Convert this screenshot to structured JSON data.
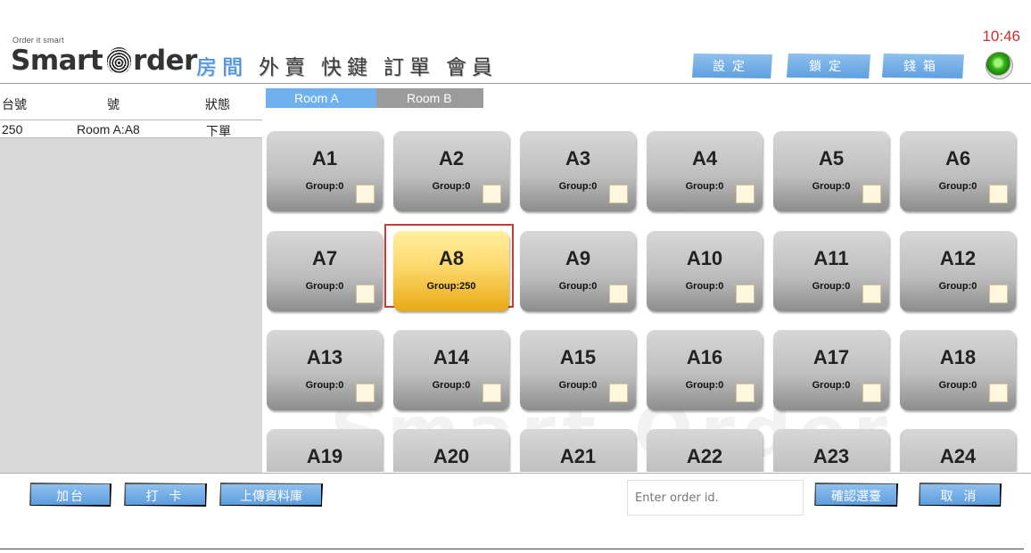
{
  "header": {
    "tagline": "Order it smart",
    "brand_left": "Smart",
    "brand_right": "rder",
    "clock": "10:46",
    "nav": [
      {
        "label": "房間",
        "active": true
      },
      {
        "label": "外賣",
        "active": false
      },
      {
        "label": "快鍵",
        "active": false
      },
      {
        "label": "訂單",
        "active": false
      },
      {
        "label": "會員",
        "active": false
      }
    ],
    "settings_label": "設定",
    "lock_label": "鎖定",
    "cashbox_label": "錢箱",
    "status_color": "#39b51a"
  },
  "left_panel": {
    "columns": [
      "台號",
      "號",
      "狀態"
    ],
    "rows": [
      {
        "table": "250",
        "number": "Room A:A8",
        "status": "下單"
      }
    ]
  },
  "rooms": {
    "tabs": [
      {
        "label": "Room A",
        "active": true
      },
      {
        "label": "Room B",
        "active": false
      }
    ]
  },
  "tables": [
    {
      "name": "A1",
      "group": "Group:0",
      "selected": false
    },
    {
      "name": "A2",
      "group": "Group:0",
      "selected": false
    },
    {
      "name": "A3",
      "group": "Group:0",
      "selected": false
    },
    {
      "name": "A4",
      "group": "Group:0",
      "selected": false
    },
    {
      "name": "A5",
      "group": "Group:0",
      "selected": false
    },
    {
      "name": "A6",
      "group": "Group:0",
      "selected": false
    },
    {
      "name": "A7",
      "group": "Group:0",
      "selected": false
    },
    {
      "name": "A8",
      "group": "Group:250",
      "selected": true
    },
    {
      "name": "A9",
      "group": "Group:0",
      "selected": false
    },
    {
      "name": "A10",
      "group": "Group:0",
      "selected": false
    },
    {
      "name": "A11",
      "group": "Group:0",
      "selected": false
    },
    {
      "name": "A12",
      "group": "Group:0",
      "selected": false
    },
    {
      "name": "A13",
      "group": "Group:0",
      "selected": false
    },
    {
      "name": "A14",
      "group": "Group:0",
      "selected": false
    },
    {
      "name": "A15",
      "group": "Group:0",
      "selected": false
    },
    {
      "name": "A16",
      "group": "Group:0",
      "selected": false
    },
    {
      "name": "A17",
      "group": "Group:0",
      "selected": false
    },
    {
      "name": "A18",
      "group": "Group:0",
      "selected": false
    },
    {
      "name": "A19",
      "group": "",
      "selected": false
    },
    {
      "name": "A20",
      "group": "",
      "selected": false
    },
    {
      "name": "A21",
      "group": "",
      "selected": false
    },
    {
      "name": "A22",
      "group": "",
      "selected": false
    },
    {
      "name": "A23",
      "group": "",
      "selected": false
    },
    {
      "name": "A24",
      "group": "",
      "selected": false
    }
  ],
  "footer": {
    "add_table_label": "加台",
    "clock_in_label": "打 卡",
    "upload_label": "上傳資料庫",
    "order_id_placeholder": "Enter order id.",
    "confirm_label": "確認選臺",
    "cancel_label": "取 消"
  },
  "accent_color": "#6fb0ef",
  "highlight_color": "#c93a3a"
}
